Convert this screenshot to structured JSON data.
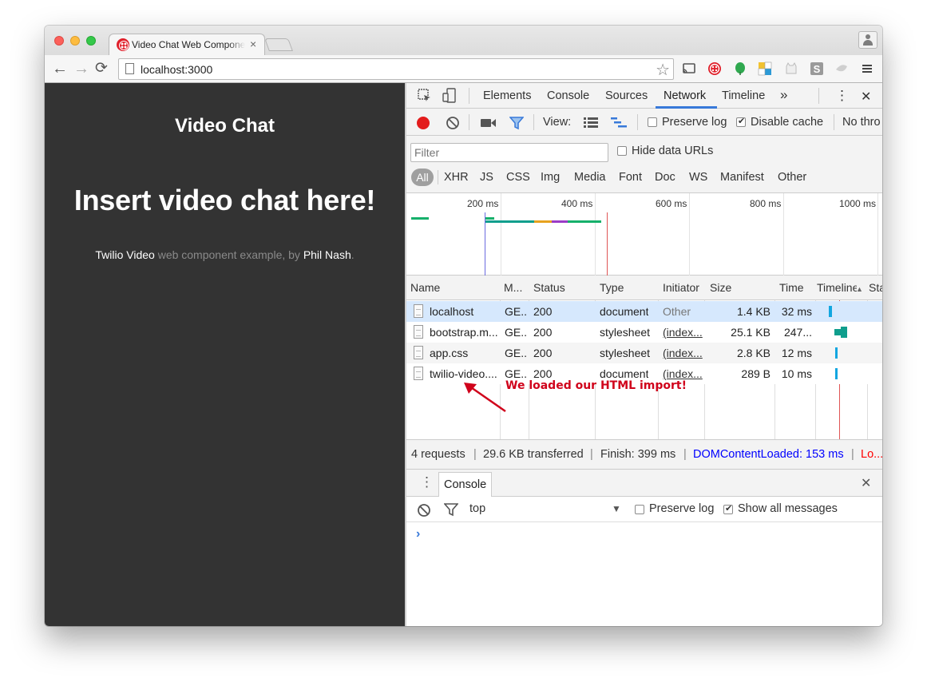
{
  "browser": {
    "tab_title": "Video Chat Web Component",
    "tab_close": "×",
    "url": "localhost:3000",
    "icons": {
      "back": "←",
      "forward": "→",
      "reload": "⟳",
      "star": "☆"
    }
  },
  "page": {
    "heading": "Video Chat",
    "main_title": "Insert video chat here!",
    "footer": {
      "link1": "Twilio Video",
      "middle": " web component example, by ",
      "link2": "Phil Nash",
      "end": "."
    }
  },
  "devtools": {
    "tabs": [
      "Elements",
      "Console",
      "Sources",
      "Network",
      "Timeline"
    ],
    "active_tab": "Network",
    "more": "»",
    "menu": "⋮",
    "close": "✕",
    "network_toolbar": {
      "view_label": "View:",
      "preserve_log": "Preserve log",
      "disable_cache": "Disable cache",
      "throttle": "No thro",
      "disable_cache_checked": true,
      "preserve_log_checked": false
    },
    "filter": {
      "placeholder": "Filter",
      "hide_data_urls": "Hide data URLs",
      "types": [
        "All",
        "XHR",
        "JS",
        "CSS",
        "Img",
        "Media",
        "Font",
        "Doc",
        "WS",
        "Manifest",
        "Other"
      ]
    },
    "overview_ticks": [
      "200 ms",
      "400 ms",
      "600 ms",
      "800 ms",
      "1000 ms"
    ],
    "table": {
      "headers": [
        "Name",
        "M...",
        "Status",
        "Type",
        "Initiator",
        "Size",
        "Time",
        "Timeline",
        "Sta"
      ],
      "rows": [
        {
          "name": "localhost",
          "method": "GE...",
          "status": "200",
          "type": "document",
          "initiator": "Other",
          "size": "1.4 KB",
          "time": "32 ms"
        },
        {
          "name": "bootstrap.m...",
          "method": "GE...",
          "status": "200",
          "type": "stylesheet",
          "initiator": "(index...",
          "size": "25.1 KB",
          "time": "247..."
        },
        {
          "name": "app.css",
          "method": "GE...",
          "status": "200",
          "type": "stylesheet",
          "initiator": "(index...",
          "size": "2.8 KB",
          "time": "12 ms"
        },
        {
          "name": "twilio-video....",
          "method": "GE...",
          "status": "200",
          "type": "document",
          "initiator": "(index...",
          "size": "289 B",
          "time": "10 ms"
        }
      ]
    },
    "annotation": "We loaded our HTML import!",
    "status_bar": {
      "requests": "4 requests",
      "transferred": "29.6 KB transferred",
      "finish": "Finish: 399 ms",
      "dom_content_loaded": "DOMContentLoaded: 153 ms",
      "load": "Lo..."
    },
    "drawer": {
      "tab": "Console",
      "context": "top",
      "preserve_log": "Preserve log",
      "show_all": "Show all messages",
      "show_all_checked": true,
      "prompt": "›"
    },
    "colors": {
      "accent": "#3879d9",
      "record": "#e31c1c",
      "annotation": "#d0021b",
      "dom_content_loaded": "#0000ff",
      "load": "#ff0000"
    }
  }
}
